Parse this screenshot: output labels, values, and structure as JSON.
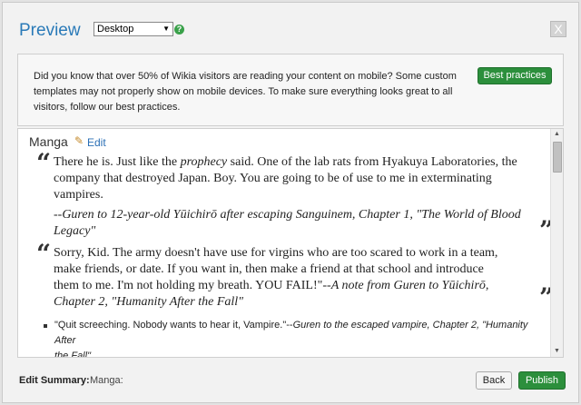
{
  "header": {
    "title": "Preview",
    "layout_select": "Desktop",
    "help_icon": "?",
    "close_icon": "X"
  },
  "notice": {
    "line1": "Did you know that over 50% of Wikia visitors are reading your content on mobile? Some custom",
    "line2": "templates may not properly show on mobile devices. To make sure everything looks great to all",
    "line3": "visitors, follow our best practices.",
    "button_label": "Best practices"
  },
  "article": {
    "heading": "Manga",
    "edit_label": "Edit",
    "quote_open_mark": "“",
    "quote_close_mark": "”",
    "quote1": {
      "line1_pre": "There he is. Just like the ",
      "line1_em": "prophecy",
      "line1_post": " said. One of the lab rats from Hyakuya Laboratories, the",
      "line2": "company that destroyed Japan. Boy. You are going to be of use to me in exterminating",
      "line3": "vampires.",
      "attrib_line1": "--Guren to 12-year-old Yūichirō after escaping Sanguinem, Chapter 1, \"The World of Blood",
      "attrib_line2": "Legacy\""
    },
    "quote2": {
      "line1": "Sorry, Kid. The army doesn't have use for virgins who are too scared to work in a team,",
      "line2": "make friends, or date. If you want in, then make a friend at that school and introduce",
      "line3_pre": "them to me. I'm not holding my breath. YOU FAIL!\"--",
      "line3_em": "A note from Guren to Yūichirō,",
      "line4": "Chapter 2, \"Humanity After the Fall\""
    },
    "bullets": [
      {
        "line1_pre": "\"Quit screeching. Nobody wants to hear it, Vampire.\"--",
        "line1_em": "Guren to the escaped vampire, Chapter 2, \"Humanity After",
        "line2_em": "the Fall\""
      }
    ]
  },
  "footer": {
    "summary_label": "Edit Summary:",
    "summary_value": "Manga:",
    "back_label": "Back",
    "publish_label": "Publish"
  }
}
